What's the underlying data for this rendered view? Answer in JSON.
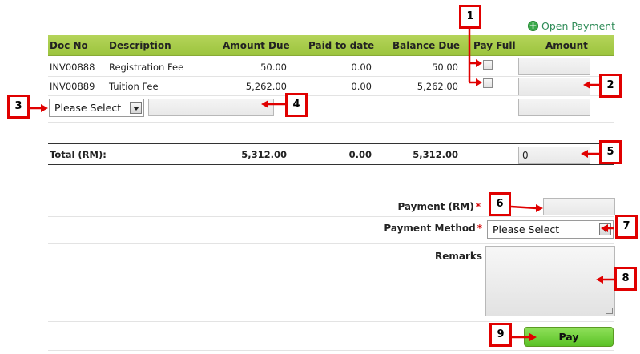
{
  "open_payment_label": "Open Payment",
  "table": {
    "headers": [
      "Doc No",
      "Description",
      "Amount Due",
      "Paid to date",
      "Balance Due",
      "Pay Full",
      "Amount"
    ],
    "rows": [
      {
        "doc_no": "INV00888",
        "description": "Registration Fee",
        "amount_due": "50.00",
        "paid_to_date": "0.00",
        "balance_due": "50.00"
      },
      {
        "doc_no": "INV00889",
        "description": "Tuition Fee",
        "amount_due": "5,262.00",
        "paid_to_date": "0.00",
        "balance_due": "5,262.00"
      }
    ],
    "extra_row": {
      "select_value": "Please Select"
    }
  },
  "totals": {
    "label": "Total (RM):",
    "amount_due": "5,312.00",
    "paid_to_date": "0.00",
    "balance_due": "5,312.00",
    "amount": "0"
  },
  "form": {
    "payment_label": "Payment (RM)",
    "payment_method_label": "Payment Method",
    "payment_method_value": "Please Select",
    "remarks_label": "Remarks",
    "required_mark": "*",
    "pay_button": "Pay"
  },
  "callouts": [
    "1",
    "2",
    "3",
    "4",
    "5",
    "6",
    "7",
    "8",
    "9"
  ],
  "colors": {
    "header_green": "#9cc43d",
    "callout_red": "#e00000",
    "pay_green": "#5bc226"
  }
}
